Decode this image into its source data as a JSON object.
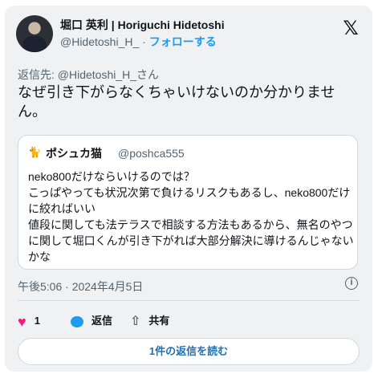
{
  "author": {
    "display_name": "堀口 英利 | Horiguchi Hidetoshi",
    "handle": "@Hidetoshi_H_",
    "separator": " · ",
    "follow_label": "フォローする"
  },
  "logo": "𝕏",
  "tweet": {
    "reply_to": "返信先: @Hidetoshi_H_さん",
    "text_lines": [
      "なぜ引き下がらなくちゃいけないのか分かりませ",
      "ん。"
    ],
    "timestamp": "午後5:06 · 2024年4月5日"
  },
  "quote": {
    "avatar_icon": "🐈",
    "name": "ポシュカ猫",
    "handle": "@poshca555",
    "lines": [
      "neko800だけならいけるのでは？",
      "こっぱやっても状況次第で負けるリスクもあるし、neko800だけ",
      "に絞ればいい",
      "値段に関しても法テラスで相談する方法もあるから、無名のやつ",
      "に関して堀口くんが引き下がれば大部分解決に導けるんじゃない",
      "かな"
    ]
  },
  "actions": {
    "like_count": "1",
    "reply_label": "返信",
    "share_label": "共有"
  },
  "read_replies_label": "1件の返信を読む",
  "icons": {
    "avatar": "avatar",
    "x_logo": "x-logo-icon",
    "info": "info-icon",
    "heart": "heart-icon",
    "reply": "reply-bubble-icon",
    "share": "share-icon"
  },
  "colors": {
    "accent": "#1d9bf0",
    "like": "#f91880",
    "secondary_text": "#536471",
    "card_bg": "#eff1f3"
  }
}
